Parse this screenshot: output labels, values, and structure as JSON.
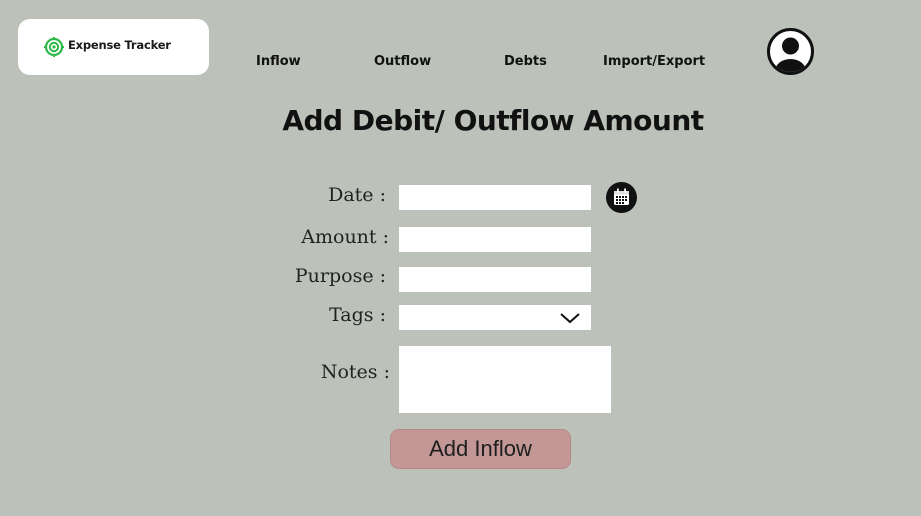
{
  "header": {
    "logo_text": "Expense Tracker",
    "nav": {
      "inflow": "Inflow",
      "outflow": "Outflow",
      "debts": "Debts",
      "import_export": "Import/Export"
    }
  },
  "page": {
    "title": "Add Debit/ Outflow Amount"
  },
  "form": {
    "date_label": "Date :",
    "amount_label": "Amount :",
    "purpose_label": "Purpose :",
    "tags_label": "Tags :",
    "notes_label": "Notes :",
    "date_value": "",
    "amount_value": "",
    "purpose_value": "",
    "tags_value": "",
    "notes_value": "",
    "submit_label": "Add Inflow"
  },
  "icons": {
    "logo": "target-icon",
    "calendar": "calendar-icon",
    "tags_dropdown": "chevron-down-icon",
    "avatar": "user-avatar-icon"
  },
  "colors": {
    "background": "#bcc1ba",
    "logo_accent": "#2fb84a",
    "submit_button": "#c49797"
  }
}
